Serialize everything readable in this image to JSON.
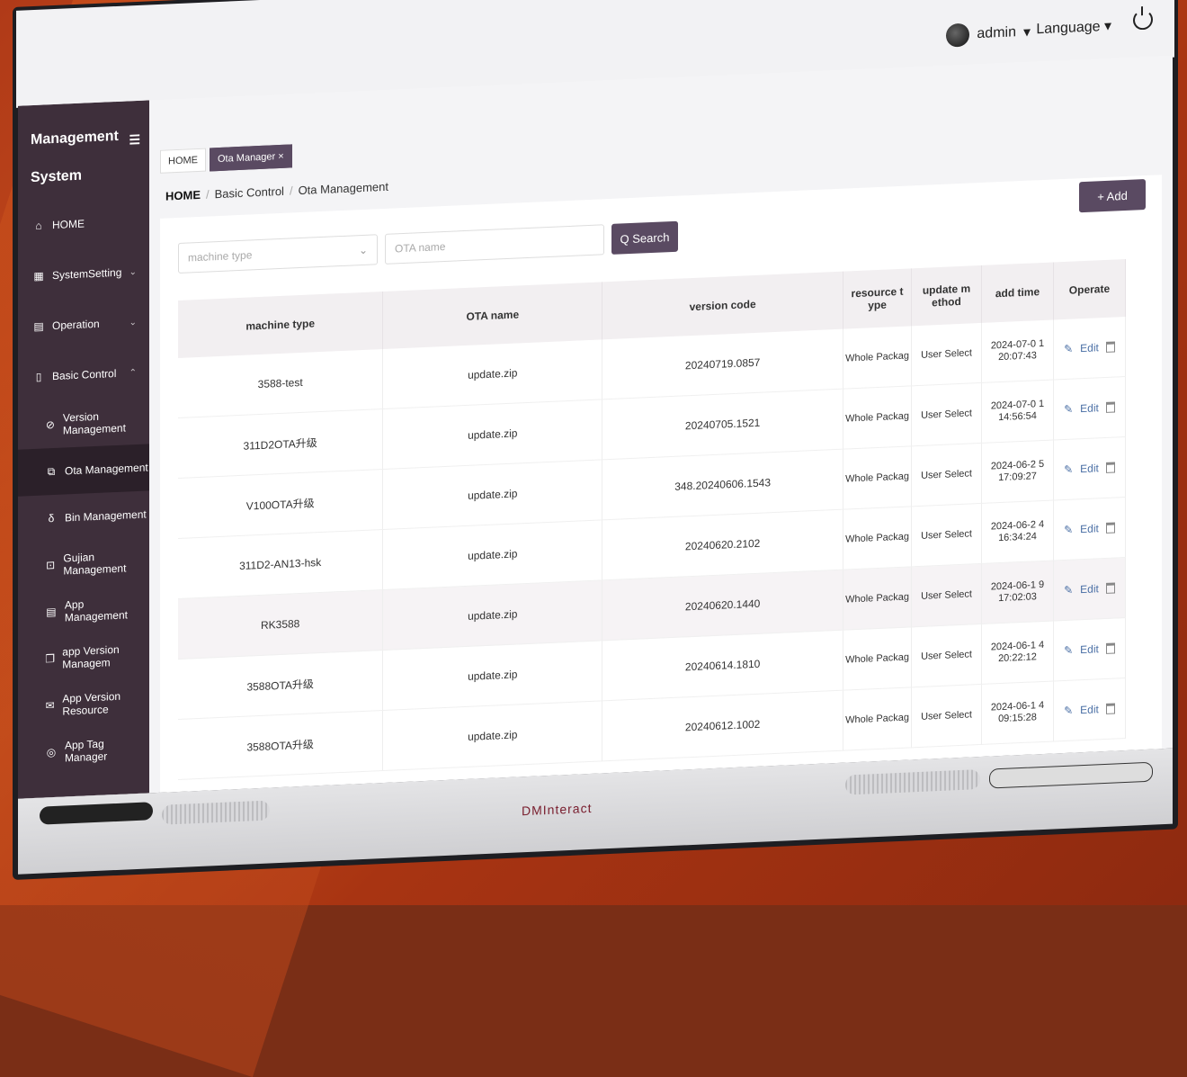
{
  "header": {
    "user": "admin",
    "language": "Language"
  },
  "sidebar": {
    "title_line1": "Management",
    "title_line2": "System",
    "items": [
      {
        "label": "HOME"
      },
      {
        "label": "SystemSetting"
      },
      {
        "label": "Operation"
      },
      {
        "label": "Basic Control"
      },
      {
        "label": "Version Management"
      },
      {
        "label": "Ota Management"
      },
      {
        "label": "Bin Management"
      },
      {
        "label": "Gujian Management"
      },
      {
        "label": "App Management"
      },
      {
        "label": "app Version Managem"
      },
      {
        "label": "App Version Resource"
      },
      {
        "label": "App Tag Manager"
      }
    ]
  },
  "tabs": {
    "home": "HOME",
    "active": "Ota Manager ×"
  },
  "breadcrumb": {
    "home": "HOME",
    "section": "Basic Control",
    "page": "Ota Management"
  },
  "filters": {
    "machine_type_placeholder": "machine type",
    "ota_name_placeholder": "OTA name",
    "search_label": "Q Search",
    "add_label": "+ Add"
  },
  "table": {
    "headers": [
      "machine type",
      "OTA name",
      "version code",
      "resource t ype",
      "update m ethod",
      "add time",
      "Operate"
    ],
    "edit_label": "Edit",
    "rows": [
      {
        "machine": "3588-test",
        "ota": "update.zip",
        "version": "20240719.0857",
        "resource": "Whole Packag",
        "method": "User Select",
        "time": "2024-07-0 1 20:07:43"
      },
      {
        "machine": "311D2OTA升级",
        "ota": "update.zip",
        "version": "20240705.1521",
        "resource": "Whole Packag",
        "method": "User Select",
        "time": "2024-07-0 1 14:56:54"
      },
      {
        "machine": "V100OTA升级",
        "ota": "update.zip",
        "version": "348.20240606.1543",
        "resource": "Whole Packag",
        "method": "User Select",
        "time": "2024-06-2 5 17:09:27"
      },
      {
        "machine": "311D2-AN13-hsk",
        "ota": "update.zip",
        "version": "20240620.2102",
        "resource": "Whole Packag",
        "method": "User Select",
        "time": "2024-06-2 4 16:34:24"
      },
      {
        "machine": "RK3588",
        "ota": "update.zip",
        "version": "20240620.1440",
        "resource": "Whole Packag",
        "method": "User Select",
        "time": "2024-06-1 9 17:02:03"
      },
      {
        "machine": "3588OTA升级",
        "ota": "update.zip",
        "version": "20240614.1810",
        "resource": "Whole Packag",
        "method": "User Select",
        "time": "2024-06-1 4 20:22:12"
      },
      {
        "machine": "3588OTA升级",
        "ota": "update.zip",
        "version": "20240612.1002",
        "resource": "Whole Packag",
        "method": "User Select",
        "time": "2024-06-1 4 09:15:28"
      }
    ]
  },
  "brand": "DMInteract"
}
